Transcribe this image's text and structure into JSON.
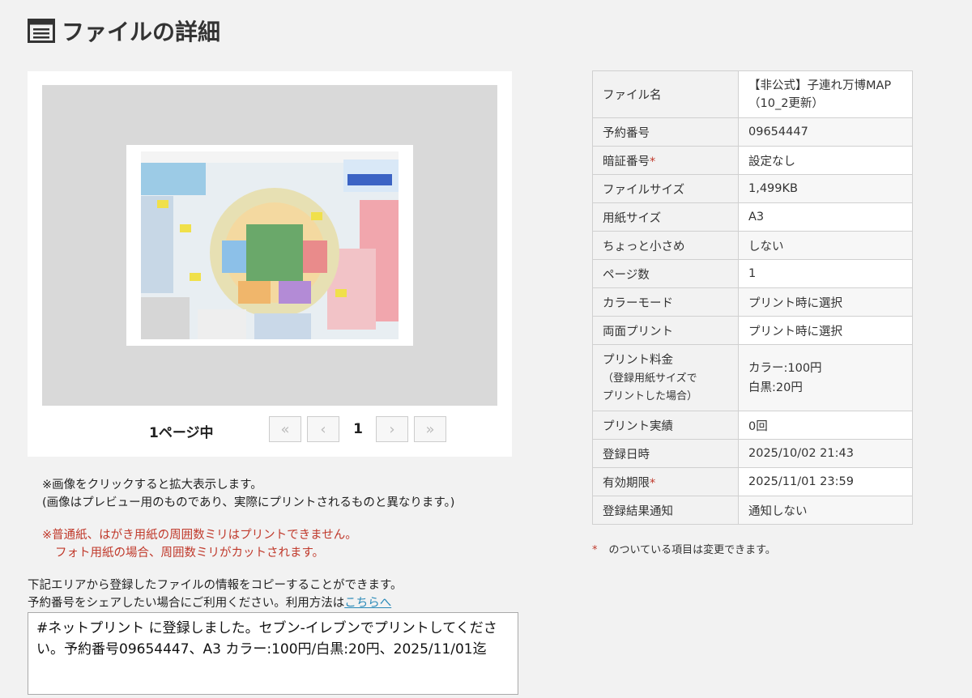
{
  "page": {
    "title": "ファイルの詳細"
  },
  "preview": {
    "page_label": "1ページ中",
    "current_page": "1",
    "first_glyph": "«",
    "prev_glyph": "‹",
    "next_glyph": "›",
    "last_glyph": "»"
  },
  "notes": {
    "line1": "※画像をクリックすると拡大表示します。",
    "line2": "(画像はプレビュー用のものであり、実際にプリントされるものと異なります。)"
  },
  "warning": {
    "line1": "※普通紙、はがき用紙の周囲数ミリはプリントできません。",
    "line2": "フォト用紙の場合、周囲数ミリがカットされます。"
  },
  "copy": {
    "line1": "下記エリアから登録したファイルの情報をコピーすることができます。",
    "line2": "予約番号をシェアしたい場合にご利用ください。利用方法は",
    "link": "こちらへ",
    "text": "#ネットプリント に登録しました。セブン-イレブンでプリントしてください。予約番号09654447、A3 カラー:100円/白黒:20円、2025/11/01迄"
  },
  "details": {
    "file_name": {
      "label": "ファイル名",
      "value": "【非公式】子連れ万博MAP（10_2更新）"
    },
    "reserve_no": {
      "label": "予約番号",
      "value": "09654447"
    },
    "pin": {
      "label": "暗証番号",
      "mark": "*",
      "value": "設定なし"
    },
    "file_size": {
      "label": "ファイルサイズ",
      "value": "1,499KB"
    },
    "paper_size": {
      "label": "用紙サイズ",
      "value": "A3"
    },
    "small": {
      "label": "ちょっと小さめ",
      "value": "しない"
    },
    "pages": {
      "label": "ページ数",
      "value": "1"
    },
    "color_mode": {
      "label": "カラーモード",
      "value": "プリント時に選択"
    },
    "duplex": {
      "label": "両面プリント",
      "value": "プリント時に選択"
    },
    "fee": {
      "label": "プリント料金",
      "sub1": "（登録用紙サイズで",
      "sub2": "プリントした場合）",
      "color": "カラー:100円",
      "mono": "白黒:20円"
    },
    "printed": {
      "label": "プリント実績",
      "value": "0回"
    },
    "registered": {
      "label": "登録日時",
      "value": "2025/10/02 21:43"
    },
    "expiry": {
      "label": "有効期限",
      "mark": "*",
      "value": "2025/11/01 23:59"
    },
    "notify": {
      "label": "登録結果通知",
      "value": "通知しない"
    }
  },
  "footnote": {
    "mark": "*",
    "text": "のついている項目は変更できます。"
  }
}
